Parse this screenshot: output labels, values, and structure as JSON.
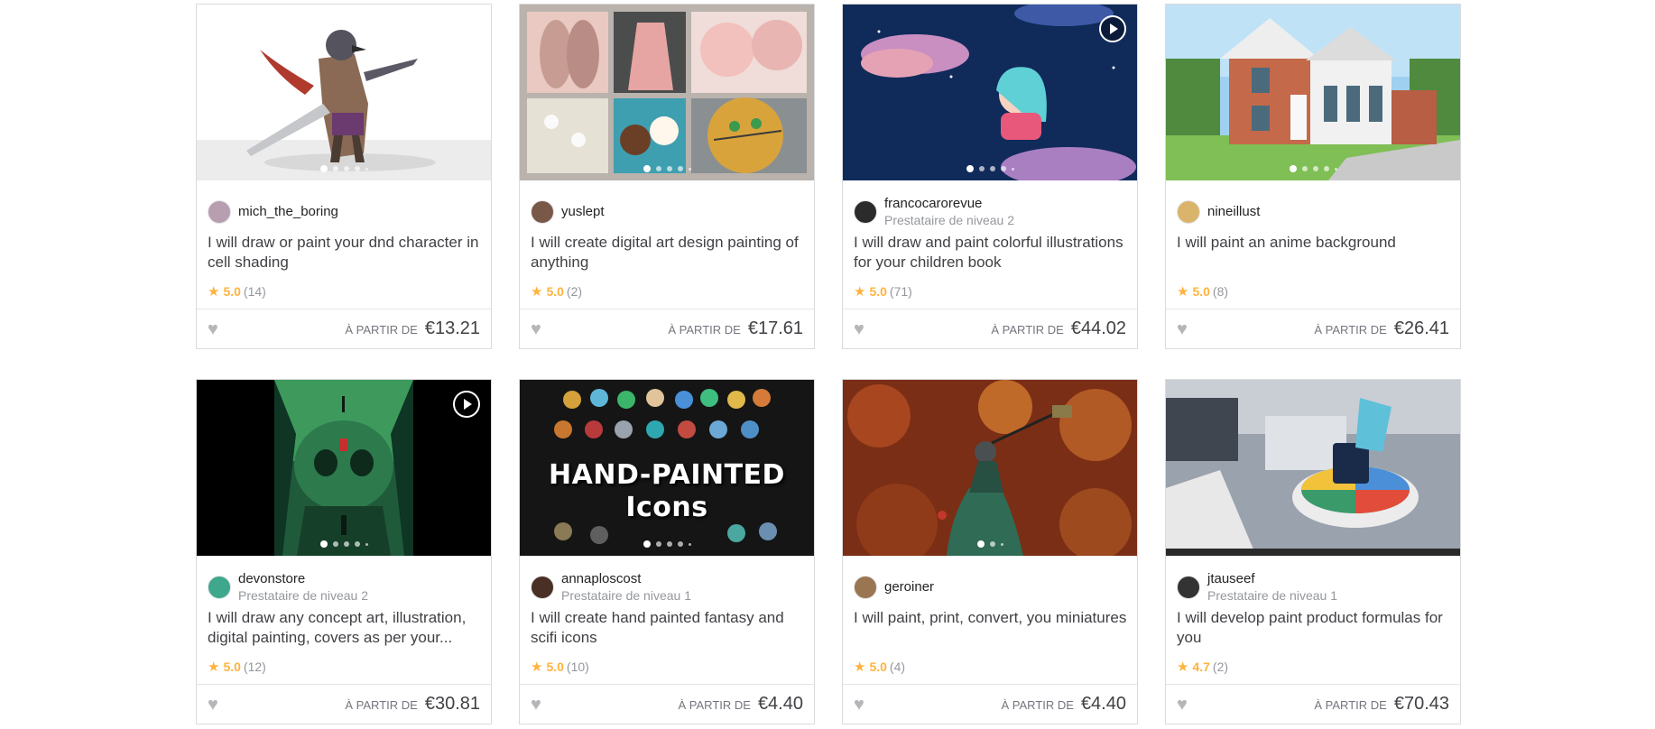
{
  "cards": [
    {
      "seller": "mich_the_boring",
      "level": "",
      "title": "I will draw or paint your dnd character in cell shading",
      "rating": "5.0",
      "reviews": "(14)",
      "from": "À PARTIR DE",
      "price": "€13.21",
      "video": false,
      "image": "dnd-character-illustration",
      "avatar_color": "#b89fb0"
    },
    {
      "seller": "yuslept",
      "level": "",
      "title": "I will create digital art design painting of anything",
      "rating": "5.0",
      "reviews": "(2)",
      "from": "À PARTIR DE",
      "price": "€17.61",
      "video": false,
      "image": "digital-painting-collage",
      "avatar_color": "#7a5848"
    },
    {
      "seller": "francocarorevue",
      "level": "Prestataire de niveau 2",
      "title": "I will draw and paint colorful illustrations for your children book",
      "rating": "5.0",
      "reviews": "(71)",
      "from": "À PARTIR DE",
      "price": "€44.02",
      "video": true,
      "image": "children-book-moon-illustration",
      "avatar_color": "#2b2b2b"
    },
    {
      "seller": "nineillust",
      "level": "",
      "title": "I will paint an anime background",
      "rating": "5.0",
      "reviews": "(8)",
      "from": "À PARTIR DE",
      "price": "€26.41",
      "video": false,
      "image": "anime-house-background",
      "avatar_color": "#d9b46a"
    },
    {
      "seller": "devonstore",
      "level": "Prestataire de niveau 2",
      "title": "I will draw any concept art, illustration, digital painting, covers as per your...",
      "rating": "5.0",
      "reviews": "(12)",
      "from": "À PARTIR DE",
      "price": "€30.81",
      "video": true,
      "image": "skull-concept-art",
      "avatar_color": "#3fa88c"
    },
    {
      "seller": "annaploscost",
      "level": "Prestataire de niveau 1",
      "title": "I will create hand painted fantasy and scifi icons",
      "rating": "5.0",
      "reviews": "(10)",
      "from": "À PARTIR DE",
      "price": "€4.40",
      "video": false,
      "image": "hand-painted-icons",
      "avatar_color": "#4a2f25",
      "overlay_line1": "HAND-PAINTED",
      "overlay_line2": "Icons"
    },
    {
      "seller": "geroiner",
      "level": "",
      "title": "I will paint, print, convert, you miniatures",
      "rating": "5.0",
      "reviews": "(4)",
      "from": "À PARTIR DE",
      "price": "€4.40",
      "video": false,
      "image": "painted-miniature",
      "avatar_color": "#9a7552"
    },
    {
      "seller": "jtauseef",
      "level": "Prestataire de niveau 1",
      "title": "I will develop paint product formulas for you",
      "rating": "4.7",
      "reviews": "(2)",
      "from": "À PARTIR DE",
      "price": "€70.43",
      "video": false,
      "image": "paint-lab-mixing",
      "avatar_color": "#333333"
    }
  ],
  "icons": {
    "star": "star-icon",
    "heart": "heart-icon",
    "play": "play-icon"
  },
  "colors": {
    "star": "#ffb33e",
    "muted": "#95979d",
    "border": "#dadbdd"
  }
}
